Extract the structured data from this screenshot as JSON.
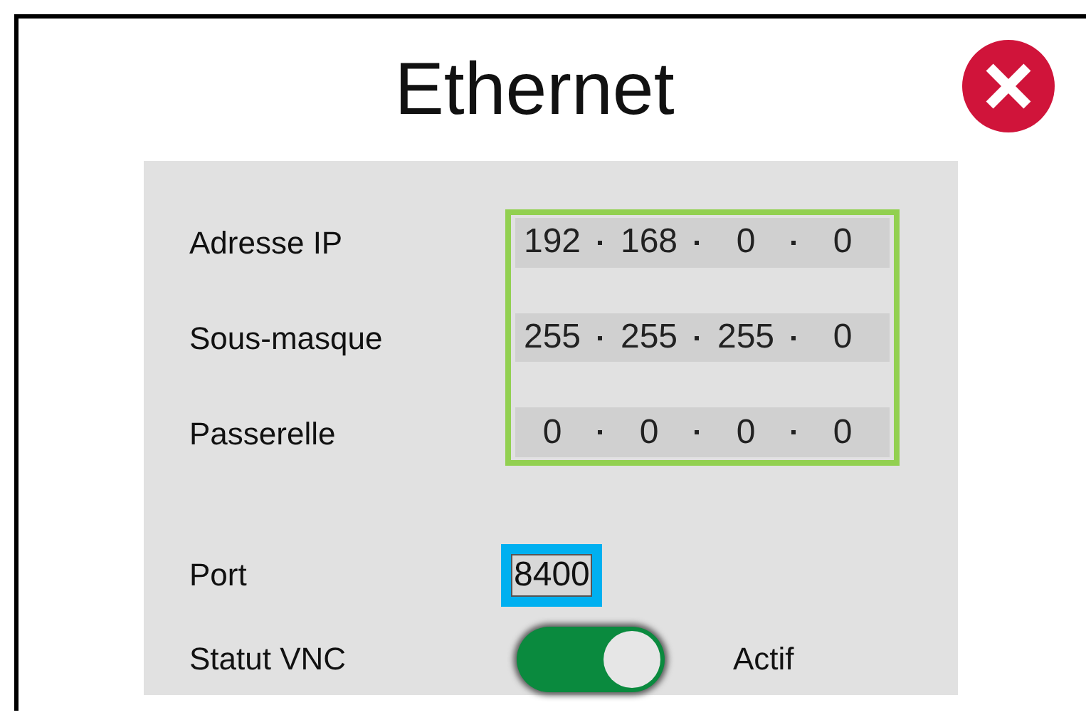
{
  "window": {
    "title": "Ethernet"
  },
  "ip_fields": [
    {
      "label": "Adresse IP",
      "octets": [
        "192",
        "168",
        "0",
        "0"
      ]
    },
    {
      "label": "Sous-masque",
      "octets": [
        "255",
        "255",
        "255",
        "0"
      ]
    },
    {
      "label": "Passerelle",
      "octets": [
        "0",
        "0",
        "0",
        "0"
      ]
    }
  ],
  "port": {
    "label": "Port",
    "value": "8400"
  },
  "vnc": {
    "label": "Statut VNC",
    "on": true,
    "status": "Actif"
  }
}
